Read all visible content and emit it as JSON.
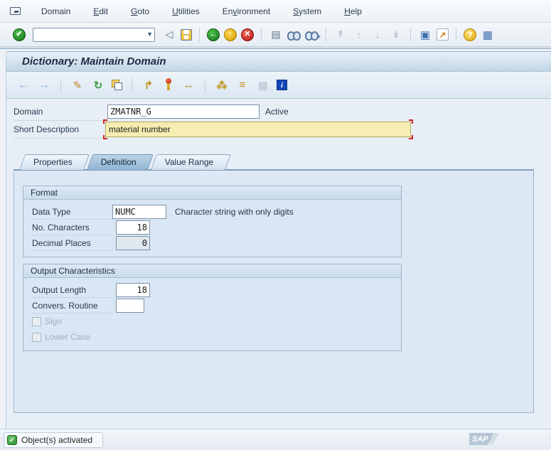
{
  "title": "Dictionary: Maintain Domain",
  "menubar": {
    "items": [
      {
        "label": "Domain",
        "underline": -1
      },
      {
        "label": "Edit",
        "underline": 0
      },
      {
        "label": "Goto",
        "underline": 0
      },
      {
        "label": "Utilities",
        "underline": 0
      },
      {
        "label": "Environment",
        "underline": 2
      },
      {
        "label": "System",
        "underline": 0
      },
      {
        "label": "Help",
        "underline": 0
      }
    ]
  },
  "toolbar": {
    "command_field": {
      "value": "",
      "placeholder": ""
    },
    "icons": {
      "enter": "✔",
      "dropdown": "▼",
      "hide_command": "◁",
      "save": "floppy-disk",
      "back": "←",
      "exit": "↑",
      "cancel": "✕",
      "print": "▤",
      "find": "binoculars",
      "find_next": "binoculars-plus",
      "plus_mark": "+",
      "first_page": "↟",
      "prev_page": "↑",
      "next_page": "↓",
      "last_page": "↡",
      "new_session": "▣",
      "shortcut": "↗",
      "help": "?",
      "customize": "▦"
    }
  },
  "app_toolbar": {
    "icons": {
      "back": "←",
      "forward": "→",
      "display_change": "✎",
      "refresh": "↻",
      "copy": "copy-pages",
      "where_used": "↱",
      "activate": "match-stick",
      "navigation": "↔",
      "hierarchy": "⁂",
      "runtime_object": "≡",
      "table": "▦",
      "info": "i"
    }
  },
  "form": {
    "domain_label": "Domain",
    "domain_value": "ZMATNR_G",
    "status": "Active",
    "short_description_label": "Short Description",
    "short_description_value": "material number"
  },
  "tabs": [
    {
      "label": "Properties",
      "active": false
    },
    {
      "label": "Definition",
      "active": true
    },
    {
      "label": "Value Range",
      "active": false
    }
  ],
  "format_section": {
    "title": "Format",
    "data_type_label": "Data Type",
    "data_type_value": "NUMC",
    "data_type_description": "Character string with only digits",
    "no_characters_label": "No. Characters",
    "no_characters_value": "18",
    "decimal_places_label": "Decimal Places",
    "decimal_places_value": "0"
  },
  "output_section": {
    "title": "Output Characteristics",
    "output_length_label": "Output Length",
    "output_length_value": "18",
    "convers_routine_label": "Convers. Routine",
    "convers_routine_value": "",
    "sign_label": "Sign",
    "lower_case_label": "Lower Case"
  },
  "statusbar": {
    "message": "Object(s) activated"
  },
  "logo": {
    "text": "SAP"
  },
  "colors": {
    "active_tab": "#8fb3d1",
    "field_highlight": "#f6edb2",
    "status_ok_green": "#3aa63a",
    "title_text": "#1b2c44",
    "sap_logo": "#b7c6d7"
  }
}
